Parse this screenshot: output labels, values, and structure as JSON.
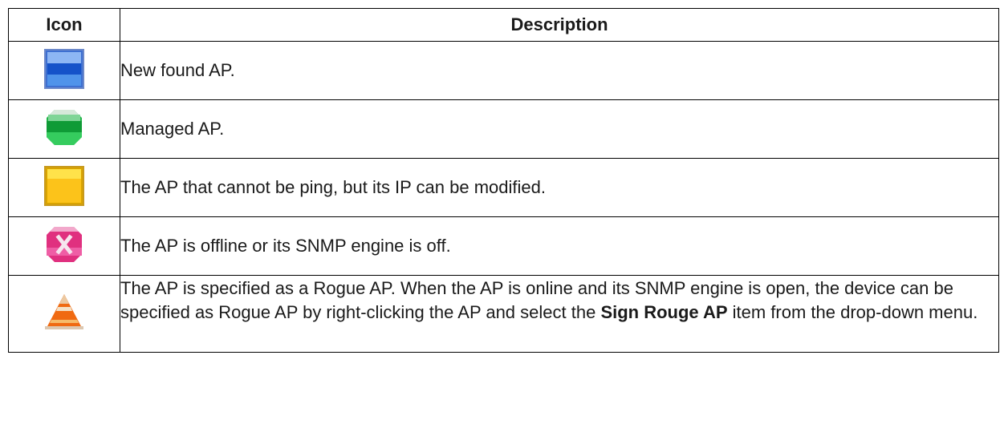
{
  "table": {
    "headers": {
      "icon": "Icon",
      "description": "Description"
    },
    "rows": [
      {
        "icon": "blue-square-ap-icon",
        "description": "New found AP."
      },
      {
        "icon": "green-ball-ap-icon",
        "description": "Managed AP."
      },
      {
        "icon": "yellow-square-ap-icon",
        "description": "The AP that cannot be ping, but its IP can be modified."
      },
      {
        "icon": "pink-x-ap-icon",
        "description": "The AP is offline or its SNMP engine is off."
      },
      {
        "icon": "orange-cone-ap-icon",
        "description_before": "The AP is specified as a Rogue AP. When the AP is online and its SNMP engine is open, the device can be specified as Rogue AP by right-clicking the AP and select the ",
        "description_bold": "Sign Rouge AP",
        "description_after": " item from the drop-down menu."
      }
    ]
  },
  "colors": {
    "blue": "#2f7de0",
    "green": "#1fc24a",
    "yellow": "#f5c000",
    "pink": "#e33a8e",
    "orange": "#f26a10"
  }
}
